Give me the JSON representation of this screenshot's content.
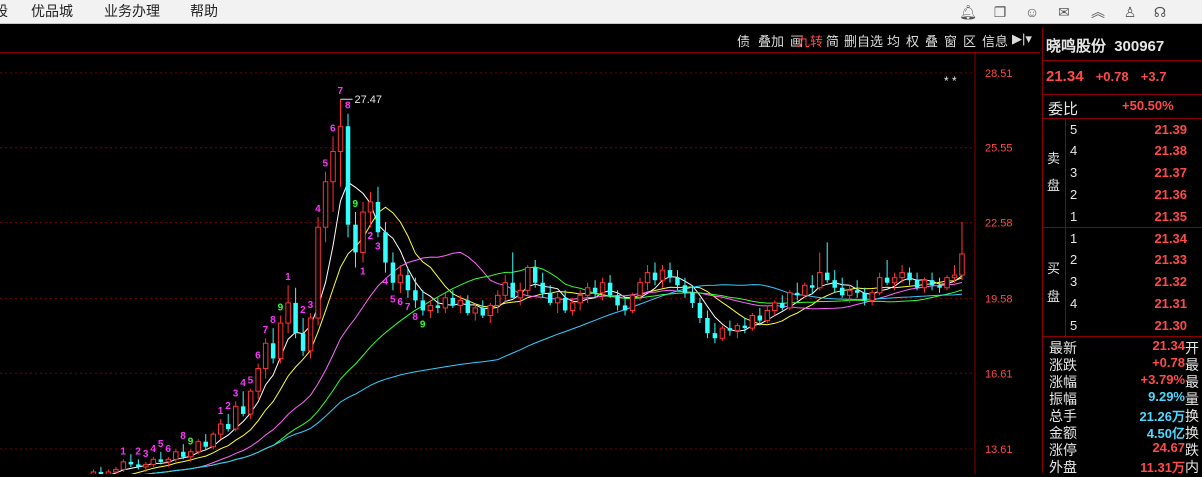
{
  "menu": {
    "items": [
      "股",
      "优品城",
      "业务办理",
      "帮助"
    ],
    "icons": [
      "bell-icon",
      "window-icon",
      "user-icon",
      "mail-icon",
      "collapse-up-icon",
      "shirt-icon",
      "headset-icon"
    ]
  },
  "chart_toolbar": {
    "items": [
      "债",
      "叠加",
      "画",
      "九转",
      "简",
      "删自选",
      "均",
      "权",
      "叠",
      "窗",
      "区",
      "信息"
    ],
    "active": "九转"
  },
  "stock": {
    "name": "晓鸣股份",
    "code": "300967",
    "price": "21.34",
    "change": "+0.78",
    "change_pct": "+3.7",
    "wei_bi_label": "委比",
    "wei_bi": "+50.50%",
    "sell_label": [
      "卖",
      "盘"
    ],
    "buy_label": [
      "买",
      "盘"
    ],
    "sell_orders": [
      {
        "level": "5",
        "price": "21.39"
      },
      {
        "level": "4",
        "price": "21.38"
      },
      {
        "level": "3",
        "price": "21.37"
      },
      {
        "level": "2",
        "price": "21.36"
      },
      {
        "level": "1",
        "price": "21.35"
      }
    ],
    "buy_orders": [
      {
        "level": "1",
        "price": "21.34"
      },
      {
        "level": "2",
        "price": "21.33"
      },
      {
        "level": "3",
        "price": "21.32"
      },
      {
        "level": "4",
        "price": "21.31"
      },
      {
        "level": "5",
        "price": "21.30"
      }
    ],
    "stats": [
      {
        "label": "最新",
        "value": "21.34",
        "color": "red",
        "right": "开"
      },
      {
        "label": "涨跌",
        "value": "+0.78",
        "color": "red",
        "right": "最"
      },
      {
        "label": "涨幅",
        "value": "+3.79%",
        "color": "red",
        "right": "最"
      },
      {
        "label": "振幅",
        "value": "9.29%",
        "color": "cyan",
        "right": "量"
      },
      {
        "label": "总手",
        "value": "21.26万",
        "color": "cyan",
        "right": "换"
      },
      {
        "label": "金额",
        "value": "4.50亿",
        "color": "cyan",
        "right": "换"
      },
      {
        "label": "涨停",
        "value": "24.67",
        "color": "red",
        "right": "跌"
      },
      {
        "label": "外盘",
        "value": "11.31万",
        "color": "red",
        "right": "内"
      }
    ]
  },
  "chart_data": {
    "type": "candlestick",
    "y_ticks": [
      "28.51",
      "25.55",
      "22.58",
      "19.58",
      "16.61",
      "13.61"
    ],
    "ylim": [
      13.61,
      28.51
    ],
    "max_label": "27.47",
    "candles": [
      [
        12.0,
        12.1,
        11.8,
        12.0
      ],
      [
        12.0,
        12.2,
        11.9,
        12.1
      ],
      [
        12.1,
        12.3,
        12.0,
        12.2
      ],
      [
        12.2,
        12.4,
        12.1,
        12.3
      ],
      [
        12.3,
        12.6,
        12.2,
        12.5
      ],
      [
        12.5,
        12.8,
        12.4,
        12.7
      ],
      [
        12.7,
        12.9,
        12.5,
        12.6
      ],
      [
        12.6,
        12.8,
        12.4,
        12.7
      ],
      [
        12.7,
        12.9,
        12.5,
        12.8
      ],
      [
        12.8,
        13.2,
        12.7,
        13.1
      ],
      [
        13.1,
        13.4,
        12.9,
        13.0
      ],
      [
        13.0,
        13.2,
        12.8,
        12.9
      ],
      [
        12.9,
        13.1,
        12.7,
        13.0
      ],
      [
        13.0,
        13.3,
        12.9,
        13.2
      ],
      [
        13.2,
        13.5,
        13.0,
        13.1
      ],
      [
        13.1,
        13.3,
        12.9,
        13.2
      ],
      [
        13.2,
        13.6,
        13.1,
        13.5
      ],
      [
        13.5,
        13.8,
        13.2,
        13.3
      ],
      [
        13.3,
        13.6,
        13.1,
        13.5
      ],
      [
        13.5,
        14.0,
        13.4,
        13.9
      ],
      [
        13.9,
        14.2,
        13.6,
        13.7
      ],
      [
        13.7,
        14.3,
        13.6,
        14.2
      ],
      [
        14.2,
        14.8,
        14.0,
        14.6
      ],
      [
        14.6,
        15.0,
        14.3,
        14.4
      ],
      [
        14.4,
        15.5,
        14.3,
        15.3
      ],
      [
        15.3,
        15.9,
        14.9,
        15.0
      ],
      [
        15.0,
        16.0,
        14.8,
        15.9
      ],
      [
        15.9,
        17.0,
        15.6,
        16.8
      ],
      [
        16.8,
        18.0,
        16.4,
        17.8
      ],
      [
        17.8,
        18.4,
        17.0,
        17.2
      ],
      [
        17.2,
        18.9,
        17.0,
        18.6
      ],
      [
        18.6,
        20.1,
        18.2,
        19.4
      ],
      [
        19.4,
        20.0,
        18.0,
        18.2
      ],
      [
        18.2,
        18.8,
        17.3,
        17.5
      ],
      [
        17.5,
        19.0,
        17.2,
        18.8
      ],
      [
        18.8,
        22.8,
        18.5,
        22.4
      ],
      [
        22.4,
        24.6,
        21.8,
        24.2
      ],
      [
        24.2,
        26.0,
        23.0,
        25.4
      ],
      [
        25.4,
        27.47,
        24.0,
        26.4
      ],
      [
        26.4,
        26.9,
        22.0,
        22.5
      ],
      [
        22.5,
        23.0,
        20.8,
        21.4
      ],
      [
        21.4,
        23.4,
        21.0,
        23.0
      ],
      [
        23.0,
        23.8,
        22.4,
        23.4
      ],
      [
        23.4,
        24.0,
        22.0,
        22.2
      ],
      [
        22.2,
        22.6,
        20.6,
        21.0
      ],
      [
        21.0,
        21.4,
        19.9,
        20.2
      ],
      [
        20.2,
        20.9,
        19.8,
        20.5
      ],
      [
        20.5,
        20.8,
        19.6,
        19.9
      ],
      [
        19.9,
        20.4,
        19.2,
        19.5
      ],
      [
        19.5,
        19.9,
        18.9,
        19.1
      ],
      [
        19.1,
        19.5,
        18.8,
        19.3
      ],
      [
        19.3,
        19.6,
        19.0,
        19.2
      ],
      [
        19.2,
        19.8,
        19.0,
        19.6
      ],
      [
        19.6,
        19.9,
        19.2,
        19.3
      ],
      [
        19.3,
        19.7,
        19.0,
        19.5
      ],
      [
        19.5,
        19.7,
        18.9,
        19.0
      ],
      [
        19.0,
        19.4,
        18.7,
        19.2
      ],
      [
        19.2,
        19.5,
        18.8,
        18.9
      ],
      [
        18.9,
        19.4,
        18.6,
        19.3
      ],
      [
        19.3,
        19.9,
        19.0,
        19.7
      ],
      [
        19.7,
        20.5,
        19.4,
        20.2
      ],
      [
        20.2,
        21.4,
        19.8,
        19.6
      ],
      [
        19.6,
        20.2,
        19.3,
        19.9
      ],
      [
        19.9,
        20.9,
        19.7,
        20.8
      ],
      [
        20.8,
        21.1,
        20.0,
        20.2
      ],
      [
        20.2,
        20.6,
        19.6,
        19.8
      ],
      [
        19.8,
        20.1,
        19.3,
        19.4
      ],
      [
        19.4,
        19.8,
        19.0,
        19.6
      ],
      [
        19.6,
        19.9,
        19.0,
        19.1
      ],
      [
        19.1,
        19.6,
        18.9,
        19.4
      ],
      [
        19.4,
        19.9,
        19.1,
        19.7
      ],
      [
        19.7,
        20.2,
        19.4,
        20.0
      ],
      [
        20.0,
        20.3,
        19.6,
        19.8
      ],
      [
        19.8,
        20.4,
        19.5,
        20.2
      ],
      [
        20.2,
        20.5,
        19.6,
        19.7
      ],
      [
        19.7,
        19.9,
        19.1,
        19.3
      ],
      [
        19.3,
        19.6,
        18.9,
        19.1
      ],
      [
        19.1,
        19.8,
        19.0,
        19.7
      ],
      [
        19.7,
        20.4,
        19.5,
        20.2
      ],
      [
        20.2,
        20.9,
        19.9,
        20.6
      ],
      [
        20.6,
        21.0,
        20.1,
        20.3
      ],
      [
        20.3,
        20.9,
        20.0,
        20.7
      ],
      [
        20.7,
        21.0,
        20.2,
        20.4
      ],
      [
        20.4,
        20.7,
        19.9,
        20.1
      ],
      [
        20.1,
        20.4,
        19.6,
        19.8
      ],
      [
        19.8,
        20.1,
        19.2,
        19.4
      ],
      [
        19.4,
        19.6,
        18.6,
        18.8
      ],
      [
        18.8,
        19.1,
        18.0,
        18.2
      ],
      [
        18.2,
        18.6,
        17.8,
        18.0
      ],
      [
        18.0,
        18.5,
        17.9,
        18.4
      ],
      [
        18.4,
        18.7,
        18.1,
        18.3
      ],
      [
        18.3,
        18.6,
        18.0,
        18.5
      ],
      [
        18.5,
        18.8,
        18.2,
        18.4
      ],
      [
        18.4,
        19.0,
        18.3,
        18.9
      ],
      [
        18.9,
        19.2,
        18.5,
        18.7
      ],
      [
        18.7,
        19.3,
        18.6,
        19.1
      ],
      [
        19.1,
        19.5,
        18.9,
        19.4
      ],
      [
        19.4,
        19.7,
        19.1,
        19.2
      ],
      [
        19.2,
        19.9,
        19.1,
        19.8
      ],
      [
        19.8,
        20.2,
        19.5,
        19.7
      ],
      [
        19.7,
        20.2,
        19.6,
        20.1
      ],
      [
        20.1,
        20.5,
        19.8,
        20.0
      ],
      [
        20.0,
        21.4,
        19.9,
        20.6
      ],
      [
        20.6,
        21.8,
        20.2,
        20.3
      ],
      [
        20.3,
        20.7,
        19.8,
        20.0
      ],
      [
        20.0,
        20.4,
        19.6,
        19.7
      ],
      [
        19.7,
        20.1,
        19.4,
        19.9
      ],
      [
        19.9,
        20.3,
        19.6,
        19.8
      ],
      [
        19.8,
        20.0,
        19.3,
        19.5
      ],
      [
        19.5,
        19.9,
        19.3,
        19.8
      ],
      [
        19.8,
        20.6,
        19.7,
        20.4
      ],
      [
        20.4,
        21.1,
        20.1,
        20.2
      ],
      [
        20.2,
        20.6,
        19.9,
        20.4
      ],
      [
        20.4,
        20.9,
        20.2,
        20.6
      ],
      [
        20.6,
        20.8,
        20.1,
        20.3
      ],
      [
        20.3,
        20.6,
        19.9,
        20.0
      ],
      [
        20.0,
        20.4,
        19.8,
        20.3
      ],
      [
        20.3,
        20.6,
        19.9,
        20.1
      ],
      [
        20.1,
        20.4,
        19.8,
        20.0
      ],
      [
        20.0,
        20.5,
        19.9,
        20.4
      ],
      [
        20.4,
        20.9,
        20.2,
        20.5
      ],
      [
        20.5,
        22.6,
        20.3,
        21.34
      ]
    ],
    "ma_series": [
      {
        "color": "#ffffff",
        "period": 5
      },
      {
        "color": "#ffff33",
        "period": 10
      },
      {
        "color": "#ff66ff",
        "period": 20
      },
      {
        "color": "#33ff33",
        "period": 30
      },
      {
        "color": "#33ccff",
        "period": 60
      }
    ],
    "nine_turn_marks": [
      {
        "i": 9,
        "label": "1"
      },
      {
        "i": 11,
        "label": "2"
      },
      {
        "i": 12,
        "label": "3"
      },
      {
        "i": 13,
        "label": "4"
      },
      {
        "i": 14,
        "label": "5"
      },
      {
        "i": 15,
        "label": "6"
      },
      {
        "i": 17,
        "label": "8"
      },
      {
        "i": 18,
        "label": "9"
      },
      {
        "i": 22,
        "label": "1"
      },
      {
        "i": 23,
        "label": "2"
      },
      {
        "i": 24,
        "label": "3"
      },
      {
        "i": 25,
        "label": "4"
      },
      {
        "i": 26,
        "label": "5"
      },
      {
        "i": 27,
        "label": "6"
      },
      {
        "i": 28,
        "label": "7"
      },
      {
        "i": 29,
        "label": "8"
      },
      {
        "i": 30,
        "label": "9"
      },
      {
        "i": 31,
        "label": "1"
      },
      {
        "i": 33,
        "label": "2"
      },
      {
        "i": 34,
        "label": "3"
      },
      {
        "i": 35,
        "label": "4"
      },
      {
        "i": 36,
        "label": "5"
      },
      {
        "i": 37,
        "label": "6"
      },
      {
        "i": 38,
        "label": "7"
      },
      {
        "i": 39,
        "label": "8"
      },
      {
        "i": 40,
        "label": "9"
      },
      {
        "i": 41,
        "label": "1"
      },
      {
        "i": 42,
        "label": "2"
      },
      {
        "i": 43,
        "label": "3"
      },
      {
        "i": 44,
        "label": "4"
      },
      {
        "i": 45,
        "label": "5"
      },
      {
        "i": 46,
        "label": "6"
      },
      {
        "i": 47,
        "label": "7"
      },
      {
        "i": 48,
        "label": "8"
      },
      {
        "i": 49,
        "label": "9"
      }
    ],
    "stars": "* *"
  }
}
